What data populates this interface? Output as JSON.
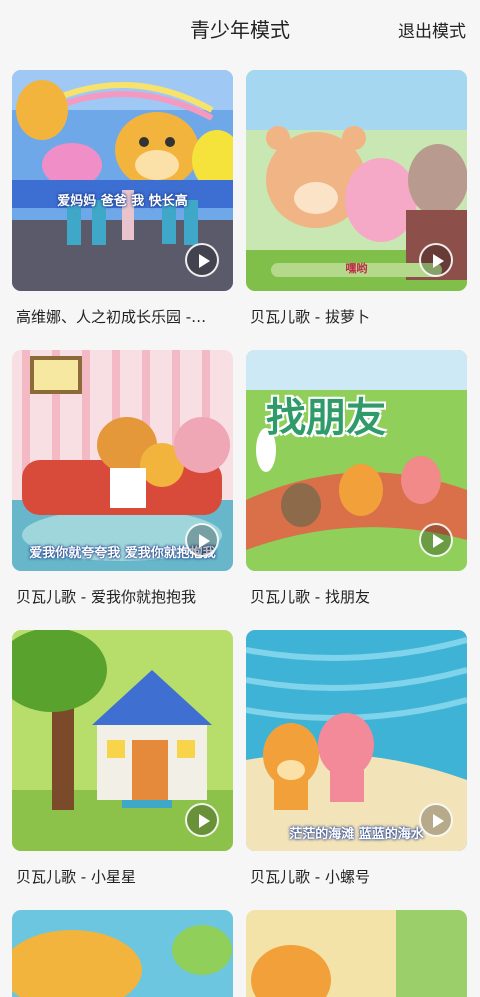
{
  "header": {
    "title": "青少年模式",
    "exit_label": "退出模式"
  },
  "videos": [
    {
      "title": "高维娜、人之初成长乐园 -…",
      "caption": "爱妈妈 爸爸 我 快长高"
    },
    {
      "title": "贝瓦儿歌 - 拔萝卜",
      "caption": "嘿哟"
    },
    {
      "title": "贝瓦儿歌 - 爱我你就抱抱我",
      "caption": "爱我你就夸夸我 爱我你就抱抱我"
    },
    {
      "title": "贝瓦儿歌 - 找朋友",
      "caption": "找朋友"
    },
    {
      "title": "贝瓦儿歌 - 小星星",
      "caption": ""
    },
    {
      "title": "贝瓦儿歌 - 小螺号",
      "caption": "茫茫的海滩 蓝蓝的海水"
    }
  ],
  "colors": {
    "background": "#f6f6f6",
    "text": "#222222"
  }
}
